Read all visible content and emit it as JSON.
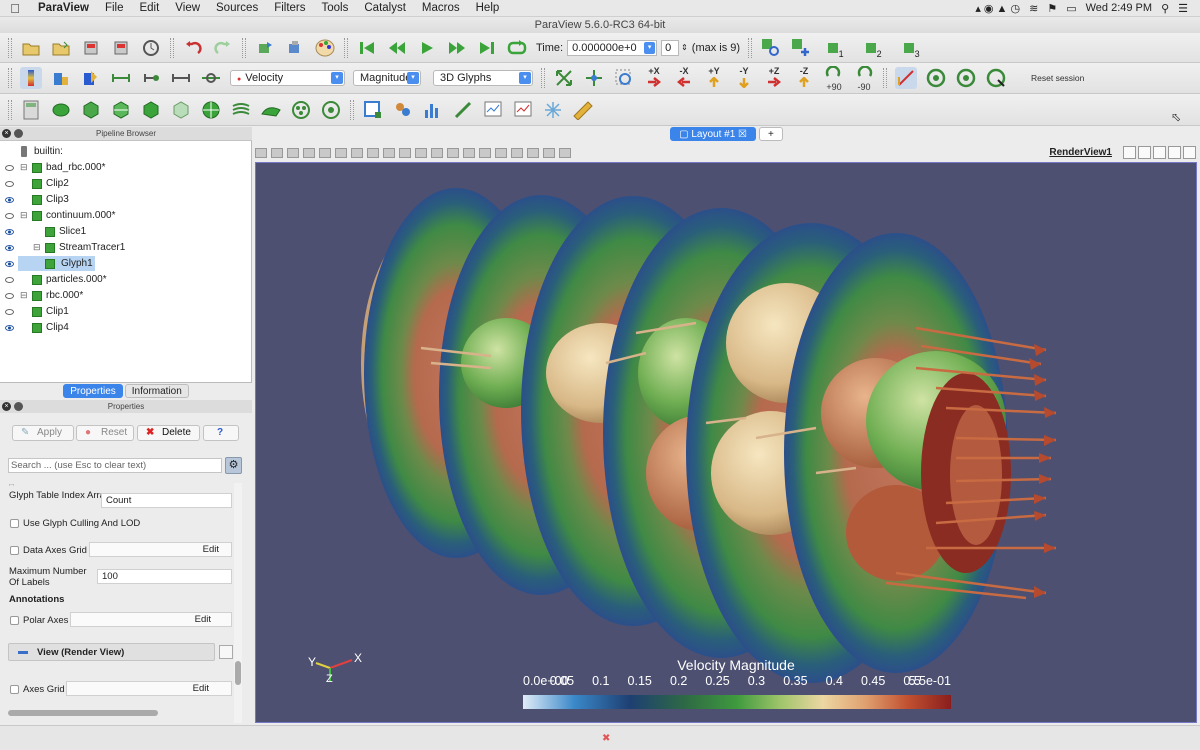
{
  "menubar": {
    "app": "ParaView",
    "items": [
      "File",
      "Edit",
      "View",
      "Sources",
      "Filters",
      "Tools",
      "Catalyst",
      "Macros",
      "Help"
    ],
    "clock": "Wed 2:49 PM"
  },
  "window": {
    "title": "ParaView 5.6.0-RC3 64-bit"
  },
  "time": {
    "label": "Time:",
    "value": "0.000000e+0",
    "index": "0",
    "max": "(max is 9)"
  },
  "camera_nums": [
    "1",
    "2",
    "3"
  ],
  "toolbar2": {
    "variable": "Velocity",
    "component": "Magnitude",
    "representation": "3D Glyphs",
    "axes": [
      "+X",
      "-X",
      "+Y",
      "-Y",
      "+Z",
      "-Z"
    ],
    "rot_plus": "+90",
    "rot_minus": "-90",
    "reset_session": "Reset session"
  },
  "pipeline": {
    "header": "Pipeline Browser",
    "items": [
      {
        "label": "builtin:",
        "visible": null,
        "level": 0
      },
      {
        "label": "bad_rbc.000*",
        "visible": false,
        "level": 1
      },
      {
        "label": "Clip2",
        "visible": false,
        "level": 1
      },
      {
        "label": "Clip3",
        "visible": true,
        "level": 1
      },
      {
        "label": "continuum.000*",
        "visible": false,
        "level": 1
      },
      {
        "label": "Slice1",
        "visible": true,
        "level": 2
      },
      {
        "label": "StreamTracer1",
        "visible": true,
        "level": 2
      },
      {
        "label": "Glyph1",
        "visible": true,
        "level": 2,
        "selected": true
      },
      {
        "label": "particles.000*",
        "visible": false,
        "level": 1
      },
      {
        "label": "rbc.000*",
        "visible": false,
        "level": 1
      },
      {
        "label": "Clip1",
        "visible": false,
        "level": 1
      },
      {
        "label": "Clip4",
        "visible": true,
        "level": 1
      }
    ]
  },
  "tabs": {
    "properties": "Properties",
    "information": "Information"
  },
  "properties": {
    "header": "Properties",
    "apply": "Apply",
    "reset": "Reset",
    "delete": "Delete",
    "help": "?",
    "search_placeholder": "Search ... (use Esc to clear text)",
    "glyph_table_label": "Glyph Table Index Array",
    "glyph_table_value": "Count",
    "culling_label": "Use Glyph Culling And LOD",
    "data_axes_grid": "Data Axes Grid",
    "edit": "Edit",
    "max_labels_label": "Maximum Number Of Labels",
    "max_labels_value": "100",
    "annotations": "Annotations",
    "polar_axes": "Polar Axes",
    "view_section": "View (Render View)",
    "axes_grid": "Axes Grid"
  },
  "layout": {
    "tab": "Layout #1",
    "add": "+",
    "view_name": "RenderView1"
  },
  "colorbar": {
    "title": "Velocity Magnitude",
    "ticks": [
      "0.0e+00",
      "0.05",
      "0.1",
      "0.15",
      "0.2",
      "0.25",
      "0.3",
      "0.35",
      "0.4",
      "0.45",
      "0.5",
      "5.5e-01"
    ],
    "colors": [
      "#e0ecf7",
      "#3a88c9",
      "#1e3f72",
      "#2e6a44",
      "#3f9a3e",
      "#9ec46a",
      "#ecd7a2",
      "#e0a070",
      "#c0502f",
      "#8a1e1e"
    ]
  },
  "orientation": {
    "x": "X",
    "y": "Y",
    "z": "Z"
  }
}
